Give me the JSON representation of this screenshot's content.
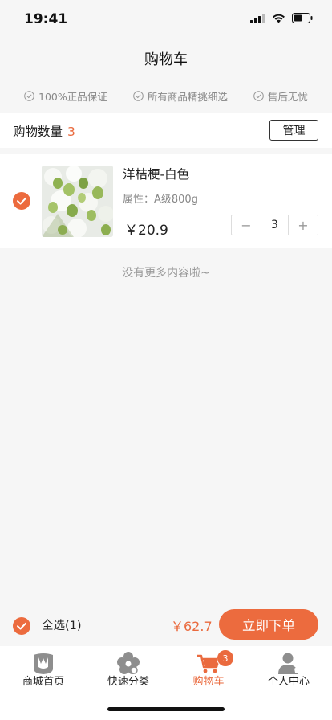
{
  "status_bar": {
    "time": "19:41"
  },
  "header": {
    "title": "购物车"
  },
  "guarantees": [
    {
      "label": "100%正品保证",
      "icon": "check-circle-icon"
    },
    {
      "label": "所有商品精挑细选",
      "icon": "check-circle-icon"
    },
    {
      "label": "售后无忧",
      "icon": "check-circle-icon"
    }
  ],
  "cart": {
    "count_label": "购物数量",
    "count": "3",
    "manage_label": "管理"
  },
  "items": [
    {
      "name": "洋桔梗-白色",
      "attr": "属性：A级800g",
      "price": "￥20.9",
      "quantity": "3",
      "minus": "−",
      "plus": "+",
      "checked": true
    }
  ],
  "list_end_text": "没有更多内容啦~",
  "checkout": {
    "select_all_label": "全选(1)",
    "total": "￥62.7",
    "order_label": "立即下单"
  },
  "tabs": [
    {
      "label": "商城首页",
      "icon": "shop-home-icon",
      "active": false
    },
    {
      "label": "快速分类",
      "icon": "category-flower-icon",
      "active": false
    },
    {
      "label": "购物车",
      "icon": "cart-icon",
      "active": true,
      "badge": "3"
    },
    {
      "label": "个人中心",
      "icon": "user-icon",
      "active": false
    }
  ],
  "colors": {
    "accent": "#ea6a3e",
    "background": "#f6f6f6"
  }
}
